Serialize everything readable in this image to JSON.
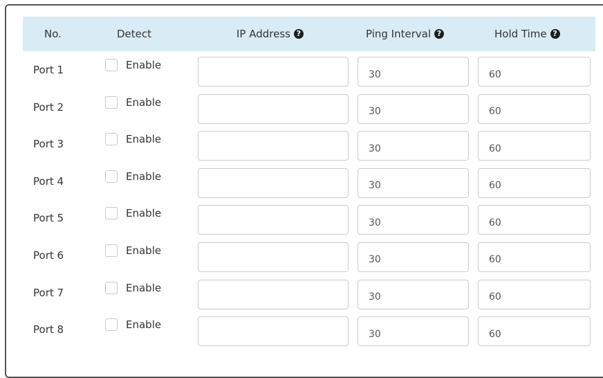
{
  "header": {
    "no": "No.",
    "detect": "Detect",
    "ip_address": "IP Address",
    "ping_interval": "Ping Interval",
    "hold_time": "Hold Time",
    "help_glyph": "?"
  },
  "rows": [
    {
      "port": "Port 1",
      "enable_label": "Enable",
      "enabled": false,
      "ip": "",
      "ping": "30",
      "hold": "60"
    },
    {
      "port": "Port 2",
      "enable_label": "Enable",
      "enabled": false,
      "ip": "",
      "ping": "30",
      "hold": "60"
    },
    {
      "port": "Port 3",
      "enable_label": "Enable",
      "enabled": false,
      "ip": "",
      "ping": "30",
      "hold": "60"
    },
    {
      "port": "Port 4",
      "enable_label": "Enable",
      "enabled": false,
      "ip": "",
      "ping": "30",
      "hold": "60"
    },
    {
      "port": "Port 5",
      "enable_label": "Enable",
      "enabled": false,
      "ip": "",
      "ping": "30",
      "hold": "60"
    },
    {
      "port": "Port 6",
      "enable_label": "Enable",
      "enabled": false,
      "ip": "",
      "ping": "30",
      "hold": "60"
    },
    {
      "port": "Port 7",
      "enable_label": "Enable",
      "enabled": false,
      "ip": "",
      "ping": "30",
      "hold": "60"
    },
    {
      "port": "Port 8",
      "enable_label": "Enable",
      "enabled": false,
      "ip": "",
      "ping": "30",
      "hold": "60"
    }
  ],
  "colors": {
    "header_bg": "#d9ecf5",
    "frame_border": "#555555",
    "input_border": "#cccccc",
    "text": "#333333"
  },
  "icons": {
    "help": "help-icon"
  }
}
